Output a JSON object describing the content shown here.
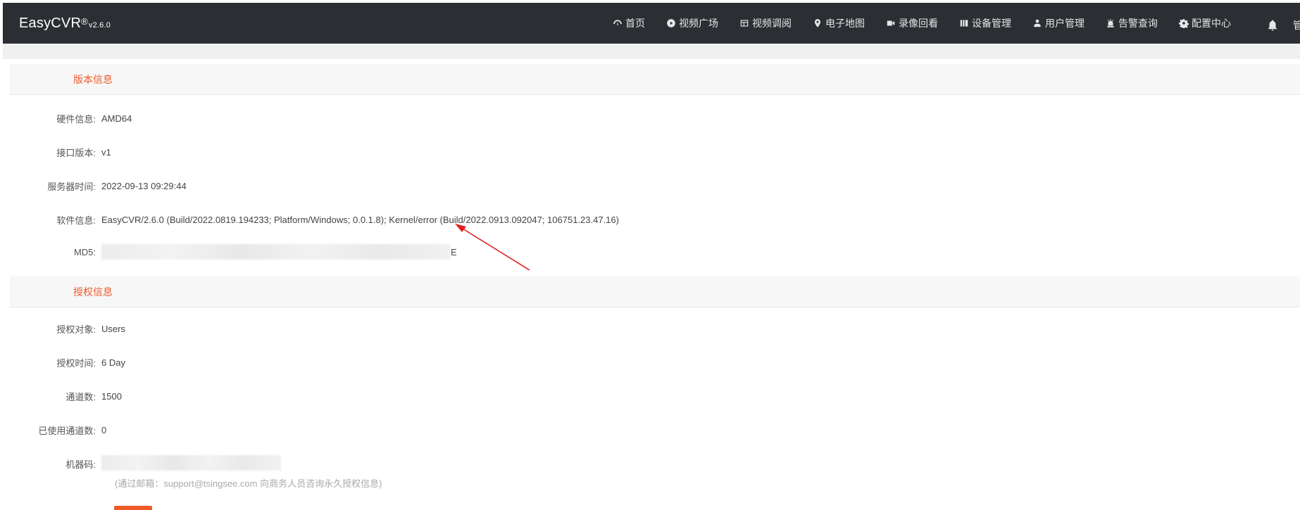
{
  "header": {
    "brand": "EasyCVR",
    "brand_reg": "®",
    "brand_version": "v2.6.0",
    "nav": [
      {
        "icon": "dashboard-icon",
        "label": "首页"
      },
      {
        "icon": "play-circle-icon",
        "label": "视频广场"
      },
      {
        "icon": "grid-icon",
        "label": "视频调阅"
      },
      {
        "icon": "map-pin-icon",
        "label": "电子地图"
      },
      {
        "icon": "video-camera-icon",
        "label": "录像回看"
      },
      {
        "icon": "device-icon",
        "label": "设备管理"
      },
      {
        "icon": "user-icon",
        "label": "用户管理"
      },
      {
        "icon": "alarm-icon",
        "label": "告警查询"
      },
      {
        "icon": "gear-icon",
        "label": "配置中心"
      }
    ],
    "bell_icon": "bell-icon",
    "user_menu_partial": "管"
  },
  "version_section": {
    "title": "版本信息",
    "rows": [
      {
        "label": "硬件信息:",
        "value": "AMD64"
      },
      {
        "label": "接口版本:",
        "value": "v1"
      },
      {
        "label": "服务器时间:",
        "value": "2022-09-13 09:29:44"
      },
      {
        "label": "软件信息:",
        "value": "EasyCVR/2.6.0 (Build/2022.0819.194233; Platform/Windows; 0.0.1.8); Kernel/error (Build/2022.0913.092047; 106751.23.47.16)"
      },
      {
        "label": "MD5:",
        "value": "E"
      }
    ]
  },
  "license_section": {
    "title": "授权信息",
    "rows": [
      {
        "label": "授权对象:",
        "value": "Users"
      },
      {
        "label": "授权时间:",
        "value": "6 Day"
      },
      {
        "label": "通道数:",
        "value": "1500"
      },
      {
        "label": "已使用通道数:",
        "value": "0"
      },
      {
        "label": "机器码:",
        "value": ""
      }
    ],
    "hint": "(通过邮箱：support@tsingsee.com 向商务人员咨询永久授权信息)"
  },
  "colors": {
    "topbar": "#2b2e32",
    "accent": "#f05a28",
    "annotation_arrow": "#e02020"
  }
}
